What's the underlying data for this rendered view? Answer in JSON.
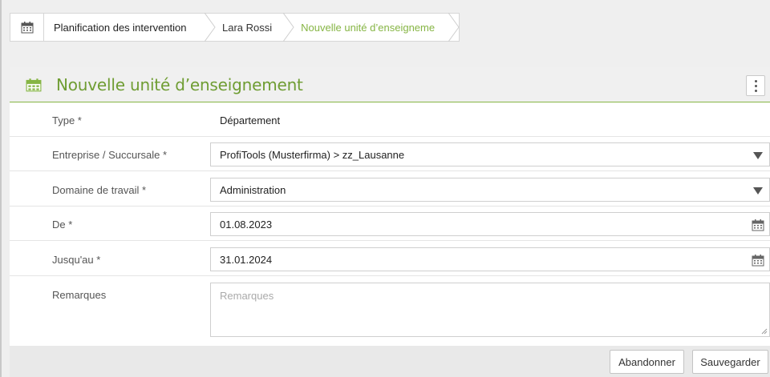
{
  "breadcrumb": {
    "items": [
      {
        "label": "Planification des intervention"
      },
      {
        "label": "Lara Rossi"
      },
      {
        "label": "Nouvelle unité d’enseigneme"
      }
    ]
  },
  "card": {
    "title": "Nouvelle unité d’enseignement"
  },
  "form": {
    "type": {
      "label": "Type *",
      "value": "Département"
    },
    "company": {
      "label": "Entreprise / Succursale *",
      "value": "ProfiTools (Musterfirma) > zz_Lausanne"
    },
    "domain": {
      "label": "Domaine de travail *",
      "value": "Administration"
    },
    "from": {
      "label": "De *",
      "value": "01.08.2023"
    },
    "until": {
      "label": "Jusqu'au *",
      "value": "31.01.2024"
    },
    "remarks": {
      "label": "Remarques",
      "placeholder": "Remarques",
      "value": ""
    }
  },
  "footer": {
    "cancel_label": "Abandonner",
    "save_label": "Sauvegarder"
  },
  "colors": {
    "accent": "#86b544",
    "title": "#6f9d33"
  },
  "icons": {
    "calendar": "calendar-icon",
    "menu": "kebab-menu-icon",
    "dropdown": "dropdown-caret-icon",
    "resize": "resize-grip-icon"
  }
}
